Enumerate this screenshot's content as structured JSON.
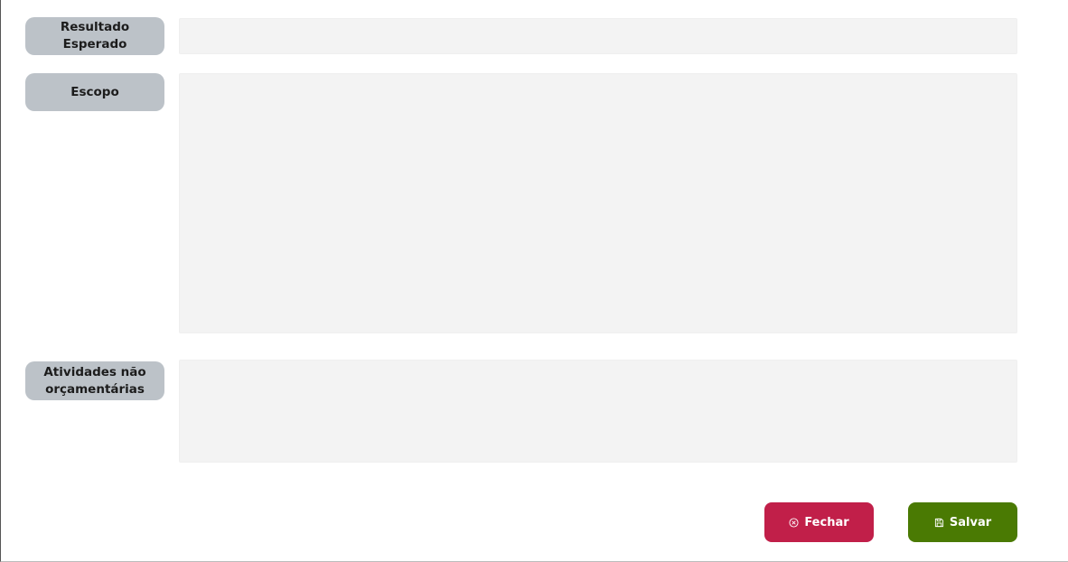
{
  "form": {
    "fields": [
      {
        "label": "Resultado Esperado",
        "value": ""
      },
      {
        "label": "Escopo",
        "value": ""
      },
      {
        "label": "Atividades não orçamentárias",
        "value": ""
      }
    ]
  },
  "actions": {
    "close_label": "Fechar",
    "close_icon": "circle-x-icon",
    "save_label": "Salvar",
    "save_icon": "floppy-disk-icon"
  },
  "colors": {
    "label_bg": "#bcc2c8",
    "field_bg": "#f3f3f3",
    "close_bg": "#c11f49",
    "save_bg": "#4a7a03"
  }
}
